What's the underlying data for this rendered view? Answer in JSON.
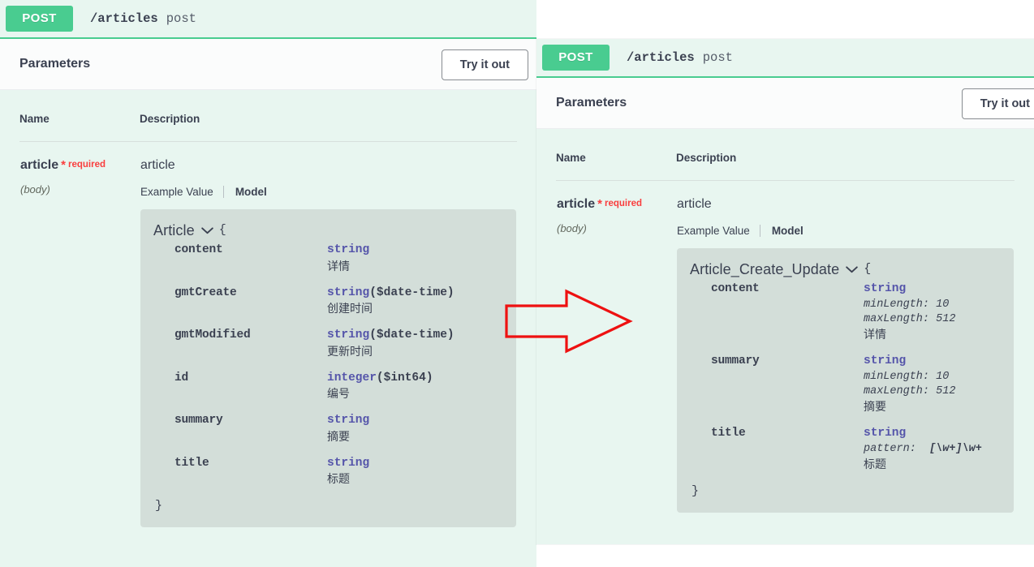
{
  "colors": {
    "method_green": "#49cc90",
    "panel_bg": "#e8f6f0",
    "model_bg": "#d3ded9",
    "required_red": "#f93e3e",
    "type_blue": "#5555aa",
    "arrow_red": "#ee1111"
  },
  "left_panel": {
    "method": "POST",
    "path": "/articles",
    "summary": "post",
    "parameters_title": "Parameters",
    "tryout_label": "Try it out",
    "columns": {
      "name": "Name",
      "description": "Description"
    },
    "parameter": {
      "name": "article",
      "required_star": "*",
      "required_label": "required",
      "location": "(body)",
      "description": "article",
      "tabs": {
        "example": "Example Value",
        "model": "Model"
      }
    },
    "model": {
      "title": "Article",
      "open_brace": "{",
      "close_brace": "}",
      "chevron": "chevron-down-icon",
      "properties": [
        {
          "name": "content",
          "type": "string",
          "format": "",
          "constraints": [],
          "cn": "详情"
        },
        {
          "name": "gmtCreate",
          "type": "string",
          "format": "($date-time)",
          "constraints": [],
          "cn": "创建时间"
        },
        {
          "name": "gmtModified",
          "type": "string",
          "format": "($date-time)",
          "constraints": [],
          "cn": "更新时间"
        },
        {
          "name": "id",
          "type": "integer",
          "format": "($int64)",
          "constraints": [],
          "cn": "编号"
        },
        {
          "name": "summary",
          "type": "string",
          "format": "",
          "constraints": [],
          "cn": "摘要"
        },
        {
          "name": "title",
          "type": "string",
          "format": "",
          "constraints": [],
          "cn": "标题"
        }
      ]
    }
  },
  "right_panel": {
    "method": "POST",
    "path": "/articles",
    "summary": "post",
    "parameters_title": "Parameters",
    "tryout_label": "Try it out",
    "columns": {
      "name": "Name",
      "description": "Description"
    },
    "parameter": {
      "name": "article",
      "required_star": "*",
      "required_label": "required",
      "location": "(body)",
      "description": "article",
      "tabs": {
        "example": "Example Value",
        "model": "Model"
      }
    },
    "model": {
      "title": "Article_Create_Update",
      "open_brace": "{",
      "close_brace": "}",
      "chevron": "chevron-down-icon",
      "properties": [
        {
          "name": "content",
          "type": "string",
          "format": "",
          "constraints": [
            "minLength: 10",
            "maxLength: 512"
          ],
          "cn": "详情"
        },
        {
          "name": "summary",
          "type": "string",
          "format": "",
          "constraints": [
            "minLength: 10",
            "maxLength: 512"
          ],
          "cn": "摘要"
        },
        {
          "name": "title",
          "type": "string",
          "format": "",
          "constraints": [
            "pattern:  [\\w+]\\w+"
          ],
          "cn": "标题"
        }
      ]
    }
  },
  "annotation": {
    "arrow": "right-arrow-annotation"
  }
}
